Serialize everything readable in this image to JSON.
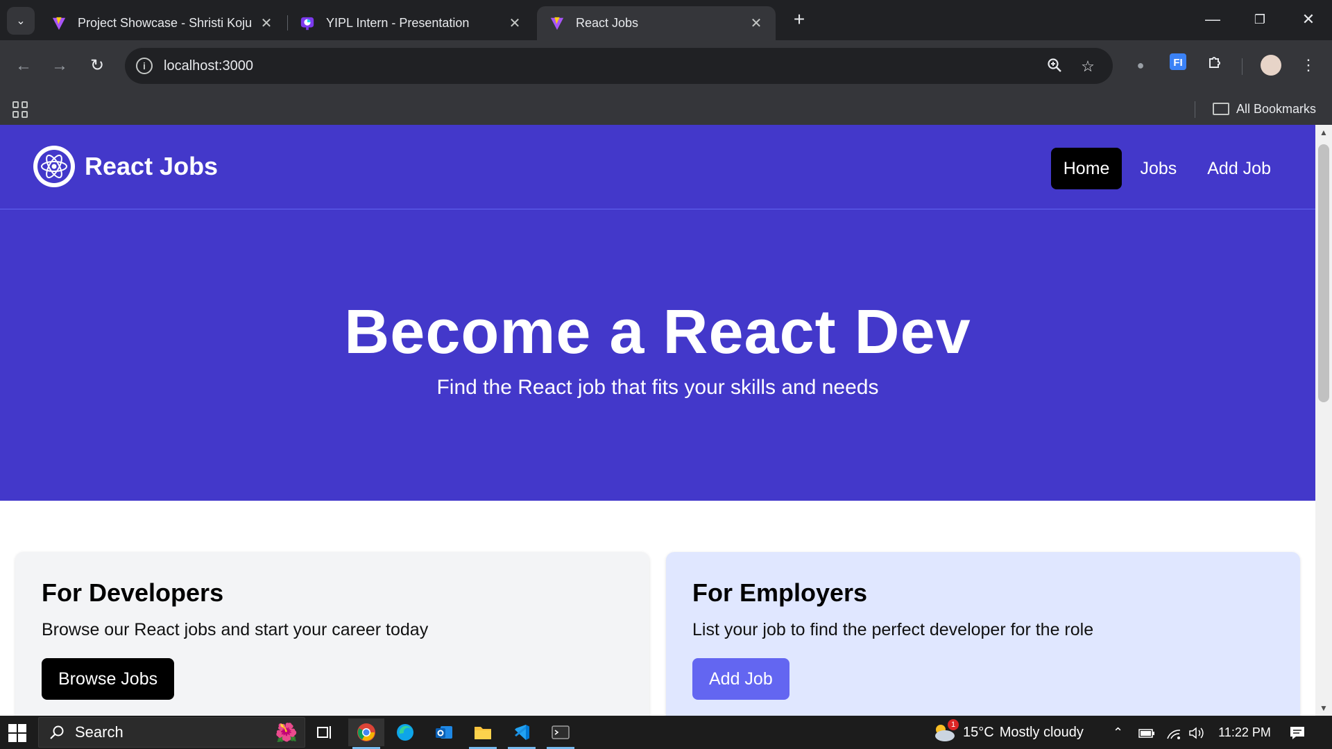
{
  "browser": {
    "tabs": [
      {
        "title": "Project Showcase - Shristi Koju",
        "active": false
      },
      {
        "title": "YIPL Intern - Presentation",
        "active": false
      },
      {
        "title": "React Jobs",
        "active": true
      }
    ],
    "url": "localhost:3000",
    "bookmarks_label": "All Bookmarks"
  },
  "page": {
    "brand": "React Jobs",
    "nav": [
      {
        "label": "Home",
        "active": true
      },
      {
        "label": "Jobs",
        "active": false
      },
      {
        "label": "Add Job",
        "active": false
      }
    ],
    "hero": {
      "title": "Become a React Dev",
      "subtitle": "Find the React job that fits your skills and needs"
    },
    "cards": {
      "developers": {
        "title": "For Developers",
        "text": "Browse our React jobs and start your career today",
        "button": "Browse Jobs"
      },
      "employers": {
        "title": "For Employers",
        "text": "List your job to find the perfect developer for the role",
        "button": "Add Job"
      }
    },
    "colors": {
      "primary": "#4338ca",
      "accent": "#6366f1",
      "dev_card": "#f3f4f6",
      "emp_card": "#e0e7ff"
    }
  },
  "taskbar": {
    "search_label": "Search",
    "weather": {
      "temp": "15°C",
      "condition": "Mostly cloudy",
      "badge": "1"
    },
    "time": "11:22 PM"
  }
}
